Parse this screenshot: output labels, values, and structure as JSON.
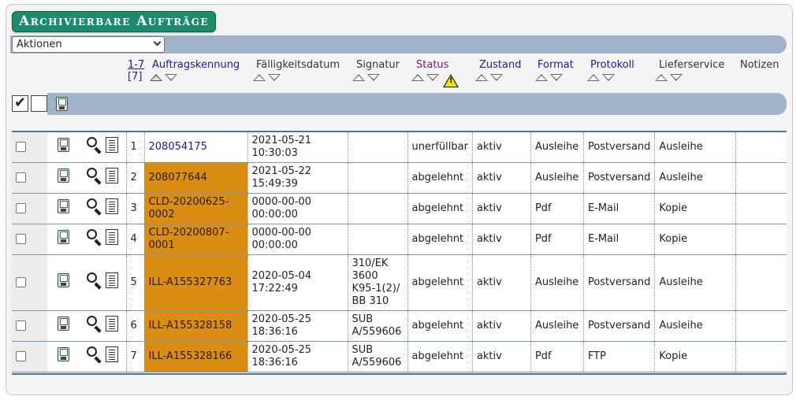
{
  "header": {
    "title": "Archivierbare Aufträge",
    "actions_select": "Aktionen"
  },
  "columns": {
    "range": "1-7",
    "count": "[7]",
    "auftragskennung": "Auftragskennung",
    "faelligkeitsdatum": "Fälligkeitsdatum",
    "signatur": "Signatur",
    "status": "Status",
    "zustand": "Zustand",
    "format": "Format",
    "protokoll": "Protokoll",
    "lieferservice": "Lieferservice",
    "notizen": "Notizen"
  },
  "bulk": {
    "select_all_mark": "✔"
  },
  "rows": [
    {
      "num": "1",
      "id": "208054175",
      "date": "2021-05-21",
      "time": "10:30:03",
      "signatur": "",
      "status": "unerfüllbar",
      "zustand": "aktiv",
      "format": "Ausleihe",
      "protokoll": "Postversand",
      "lieferservice": "Ausleihe",
      "notizen": "",
      "highlight": false
    },
    {
      "num": "2",
      "id": "208077644",
      "date": "2021-05-22",
      "time": "15:49:39",
      "signatur": "",
      "status": "abgelehnt",
      "zustand": "aktiv",
      "format": "Ausleihe",
      "protokoll": "Postversand",
      "lieferservice": "Ausleihe",
      "notizen": "",
      "highlight": true
    },
    {
      "num": "3",
      "id": "CLD-20200625-0002",
      "date": "0000-00-00",
      "time": "00:00:00",
      "signatur": "",
      "status": "abgelehnt",
      "zustand": "aktiv",
      "format": "Pdf",
      "protokoll": "E-Mail",
      "lieferservice": "Kopie",
      "notizen": "",
      "highlight": true
    },
    {
      "num": "4",
      "id": "CLD-20200807-0001",
      "date": "0000-00-00",
      "time": "00:00:00",
      "signatur": "",
      "status": "abgelehnt",
      "zustand": "aktiv",
      "format": "Pdf",
      "protokoll": "E-Mail",
      "lieferservice": "Kopie",
      "notizen": "",
      "highlight": true
    },
    {
      "num": "5",
      "id": "ILL-A155327763",
      "date": "2020-05-04",
      "time": "17:22:49",
      "signatur": "310/EK 3600 K95-1(2)/ BB 310",
      "status": "abgelehnt",
      "zustand": "aktiv",
      "format": "Ausleihe",
      "protokoll": "Postversand",
      "lieferservice": "Ausleihe",
      "notizen": "",
      "highlight": true
    },
    {
      "num": "6",
      "id": "ILL-A155328158",
      "date": "2020-05-25",
      "time": "18:36:16",
      "signatur": "SUB A/559606",
      "status": "abgelehnt",
      "zustand": "aktiv",
      "format": "Ausleihe",
      "protokoll": "Postversand",
      "lieferservice": "Ausleihe",
      "notizen": "",
      "highlight": true
    },
    {
      "num": "7",
      "id": "ILL-A155328166",
      "date": "2020-05-25",
      "time": "18:36:16",
      "signatur": "SUB A/559606",
      "status": "abgelehnt",
      "zustand": "aktiv",
      "format": "Pdf",
      "protokoll": "FTP",
      "lieferservice": "Kopie",
      "notizen": "",
      "highlight": true
    }
  ]
}
